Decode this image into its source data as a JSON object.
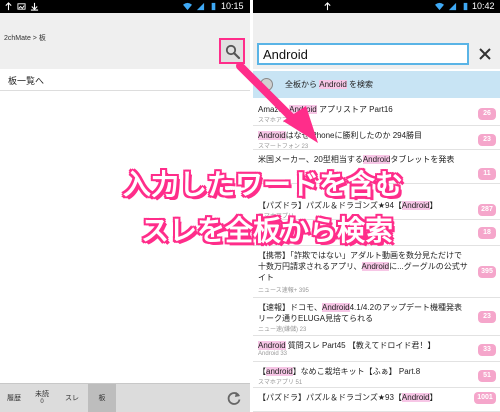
{
  "left": {
    "status": {
      "time": "10:15"
    },
    "breadcrumb": "2chMate > 板",
    "menu_item": "板一覧へ",
    "bottom_tabs": [
      {
        "label": "履歴",
        "sub": ""
      },
      {
        "label": "未読",
        "sub": "0"
      },
      {
        "label": "スレ",
        "sub": ""
      },
      {
        "label": "板",
        "sub": ""
      }
    ]
  },
  "right": {
    "status": {
      "time": "10:42"
    },
    "search": {
      "value": "Android"
    },
    "search_all": {
      "prefix": "全板から ",
      "keyword": "Android",
      "suffix": " を検索"
    },
    "results": [
      {
        "pre": "Amazon ",
        "kw": "Android",
        "post": " アプリストア Part16",
        "meta": "スマホアプリ",
        "count": "26"
      },
      {
        "pre": "",
        "kw": "Android",
        "post": "はなぜiPhoneに勝利したのか 294勝目",
        "meta": "スマートフォン 23",
        "count": "23"
      },
      {
        "pre": "米国メーカー、20型相当する",
        "kw": "Android",
        "post": "タブレットを発表",
        "meta": "",
        "count": "11"
      },
      {
        "pre": "【パズドラ】パズル＆ドラゴンズ★94【",
        "kw": "Android",
        "post": "】",
        "meta": "スマホアプリ",
        "count": "287"
      },
      {
        "pre": "",
        "kw": "",
        "post": "",
        "meta": "",
        "count": "18"
      },
      {
        "pre": "【携帯】「詐欺ではない」アダルト動画を数分見ただけで十数万円請求されるアプリ、",
        "kw": "Android",
        "post": "に...グーグルの公式サイト",
        "meta": "ニュース速報+ 395",
        "count": "395"
      },
      {
        "pre": "【速報】ドコモ、",
        "kw": "Android",
        "post": "4.1/4.2のアップデート機種発表 リーク通りELUGA見捨てられる",
        "meta": "ニュー速(嫌儲) 23",
        "count": "23"
      },
      {
        "pre": "",
        "kw": "Android",
        "post": " 質問スレ Part45 【教えてドロイド君！】",
        "meta": "Android 33",
        "count": "33"
      },
      {
        "pre": "【",
        "kw": "android",
        "post": "】なめこ栽培キット【ふぁ】 Part.8",
        "meta": "スマホアプリ 51",
        "count": "51"
      },
      {
        "pre": "【パズドラ】パズル＆ドラゴンズ★93【",
        "kw": "Android",
        "post": "】",
        "meta": "",
        "count": "1001"
      }
    ]
  },
  "overlay": {
    "line1": "入力したワードを含む",
    "line2": "スレを全板から検索",
    "color": "#ff2d8a"
  }
}
